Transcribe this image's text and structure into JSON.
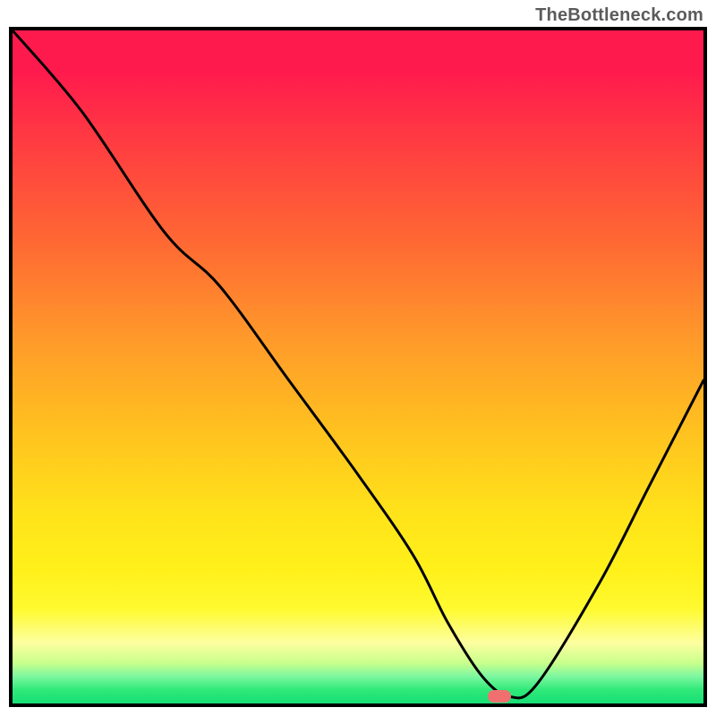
{
  "watermark": "TheBottleneck.com",
  "chart_data": {
    "type": "line",
    "title": "",
    "xlabel": "",
    "ylabel": "",
    "xlim": [
      0,
      100
    ],
    "ylim": [
      0,
      100
    ],
    "x": [
      0,
      10,
      22,
      30,
      40,
      50,
      58,
      63,
      68,
      72,
      76,
      85,
      92,
      100
    ],
    "values": [
      100,
      88,
      70,
      62,
      48,
      34,
      22,
      12,
      4,
      1,
      3,
      18,
      32,
      48
    ],
    "marker": {
      "x": 70.5,
      "y": 1
    },
    "gradient_stops": [
      {
        "pos": 0,
        "color": "#ff1a4d"
      },
      {
        "pos": 18,
        "color": "#ff4040"
      },
      {
        "pos": 46,
        "color": "#ff9a2a"
      },
      {
        "pos": 72,
        "color": "#ffe31a"
      },
      {
        "pos": 91,
        "color": "#fdffa0"
      },
      {
        "pos": 100,
        "color": "#18df76"
      }
    ]
  }
}
